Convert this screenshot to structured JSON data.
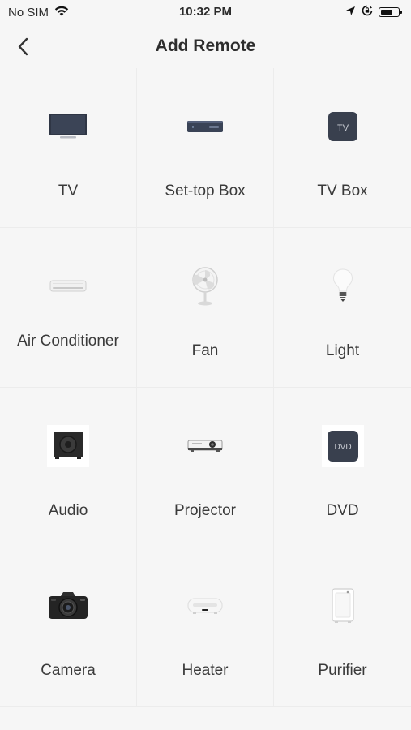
{
  "status_bar": {
    "carrier": "No SIM",
    "time": "10:32 PM",
    "icons": [
      "wifi-icon",
      "location-icon",
      "orientation-lock-icon",
      "battery-icon"
    ]
  },
  "nav": {
    "title": "Add Remote",
    "back_icon": "chevron-left-icon"
  },
  "devices": [
    {
      "label": "TV",
      "icon": "tv-icon"
    },
    {
      "label": "Set-top Box",
      "icon": "set-top-box-icon"
    },
    {
      "label": "TV Box",
      "icon": "tv-box-icon",
      "icon_text": "TV"
    },
    {
      "label": "Air Conditioner",
      "icon": "air-conditioner-icon"
    },
    {
      "label": "Fan",
      "icon": "fan-icon"
    },
    {
      "label": "Light",
      "icon": "light-bulb-icon"
    },
    {
      "label": "Audio",
      "icon": "audio-speaker-icon"
    },
    {
      "label": "Projector",
      "icon": "projector-icon"
    },
    {
      "label": "DVD",
      "icon": "dvd-icon",
      "icon_text": "DVD"
    },
    {
      "label": "Camera",
      "icon": "camera-icon"
    },
    {
      "label": "Heater",
      "icon": "heater-icon"
    },
    {
      "label": "Purifier",
      "icon": "purifier-icon"
    }
  ]
}
